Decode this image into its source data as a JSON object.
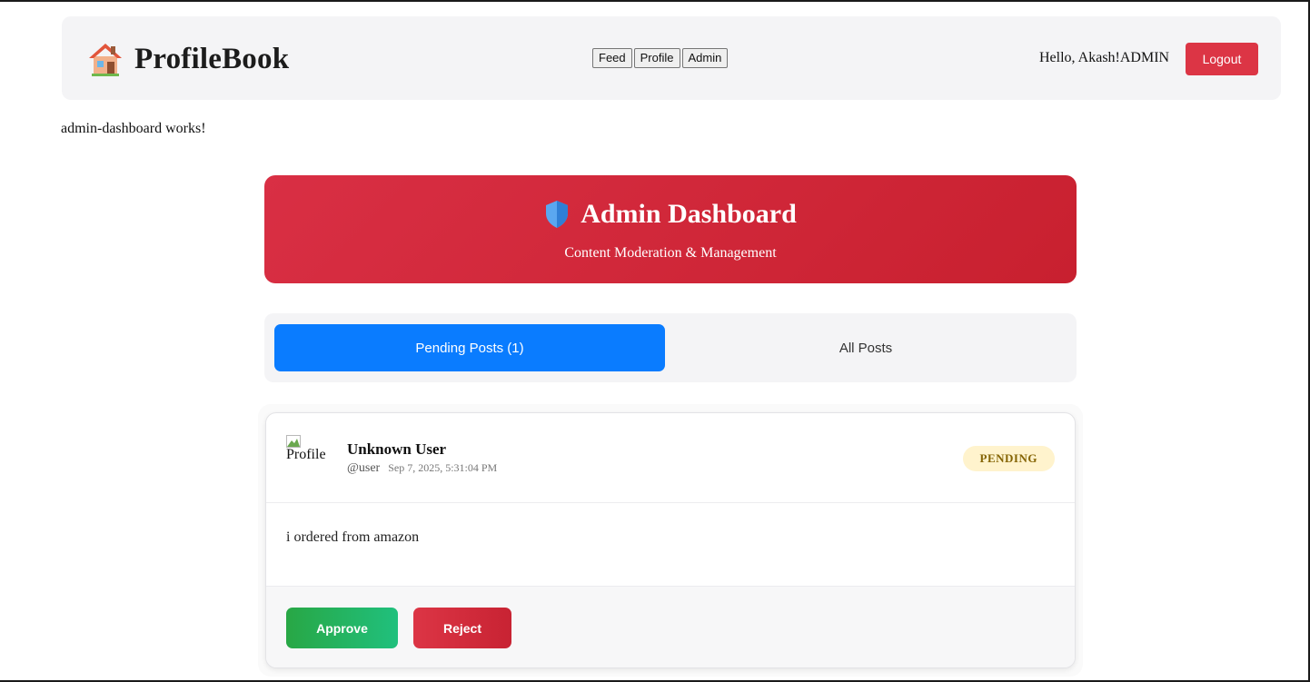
{
  "navbar": {
    "brand_icon": "house-icon",
    "brand_title": "ProfileBook",
    "links": [
      "Feed",
      "Profile",
      "Admin"
    ],
    "greeting": "Hello, Akash!ADMIN",
    "logout_label": "Logout"
  },
  "page_text": "admin-dashboard works!",
  "header": {
    "icon": "shield-icon",
    "title": "Admin Dashboard",
    "subtitle": "Content Moderation & Management"
  },
  "tabs": [
    {
      "label": "Pending Posts (1)",
      "active": true
    },
    {
      "label": "All Posts",
      "active": false
    }
  ],
  "posts": [
    {
      "avatar_alt": "Profile",
      "user_name": "Unknown User",
      "handle": "@user",
      "date": "Sep 7, 2025, 5:31:04 PM",
      "status": "PENDING",
      "content": "i ordered from amazon",
      "approve_label": "Approve",
      "reject_label": "Reject"
    }
  ],
  "colors": {
    "accent_red": "#dc3545",
    "tab_active": "#0a7cff",
    "approve_green": "#28a745",
    "pending_badge_bg": "#fff3cd",
    "pending_badge_text": "#856404"
  }
}
